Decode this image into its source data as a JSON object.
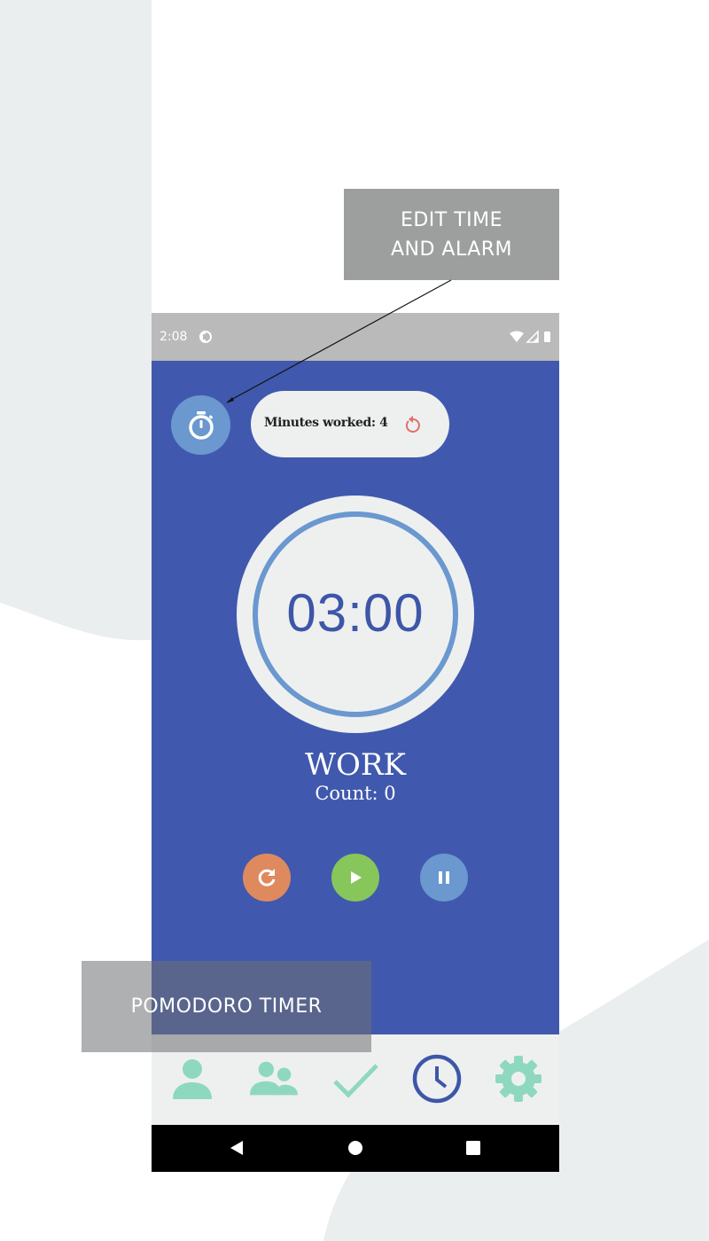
{
  "callouts": {
    "edit_line1": "EDIT TIME",
    "edit_line2": "AND ALARM",
    "pomodoro": "POMODORO TIMER"
  },
  "status_bar": {
    "time": "2:08",
    "icons": [
      "notification-icon",
      "wifi-icon",
      "signal-icon",
      "battery-icon"
    ]
  },
  "header": {
    "timer_settings_icon": "stopwatch-icon",
    "minutes_worked_label": "Minutes worked: 4",
    "reset_icon": "reset-icon"
  },
  "timer": {
    "time": "03:00",
    "mode": "WORK",
    "count_label": "Count: 0"
  },
  "controls": [
    {
      "name": "restart",
      "icon": "refresh-icon"
    },
    {
      "name": "play",
      "icon": "play-icon"
    },
    {
      "name": "pause",
      "icon": "pause-icon"
    }
  ],
  "bottom_nav": [
    {
      "name": "profile",
      "icon": "person-icon",
      "active": false
    },
    {
      "name": "group",
      "icon": "group-icon",
      "active": false
    },
    {
      "name": "tasks",
      "icon": "check-icon",
      "active": false
    },
    {
      "name": "timer",
      "icon": "clock-icon",
      "active": true
    },
    {
      "name": "settings",
      "icon": "gear-icon",
      "active": false
    }
  ],
  "system_nav": [
    "back-icon",
    "home-icon",
    "recents-icon"
  ],
  "colors": {
    "app_background": "#4059ae",
    "accent_blue": "#6a98cf",
    "restart": "#de8a5e",
    "play": "#86c65b",
    "nav_inactive": "#8fd8c0",
    "nav_active": "#3e56a8",
    "reset_icon": "#e07068"
  }
}
